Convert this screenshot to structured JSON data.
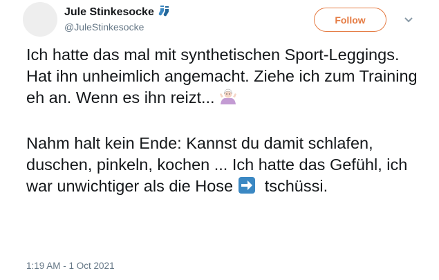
{
  "author": {
    "display_name": "Jule Stinkesocke",
    "handle": "@JuleStinkesocke",
    "badge_icon": "socks-icon"
  },
  "actions": {
    "follow_label": "Follow",
    "accent_color": "#e57c44"
  },
  "tweet": {
    "paragraph1_text": "Ich hatte das mal mit synthetischen Sport-Leggings. Hat ihn unheimlich angemacht. Ziehe ich zum Training eh an. Wenn es ihn reizt...",
    "paragraph1_emoji": "person-shrugging-icon",
    "paragraph2_text": "Nahm halt kein Ende: Kannst du damit schlafen, duschen, pinkeln, kochen ... Ich hatte das Gefühl, ich war unwichtiger als die Hose",
    "paragraph2_emoji": "right-arrow-icon",
    "paragraph2_tail": "tschüssi.",
    "timestamp": "1:19 AM - 1 Oct 2021"
  }
}
